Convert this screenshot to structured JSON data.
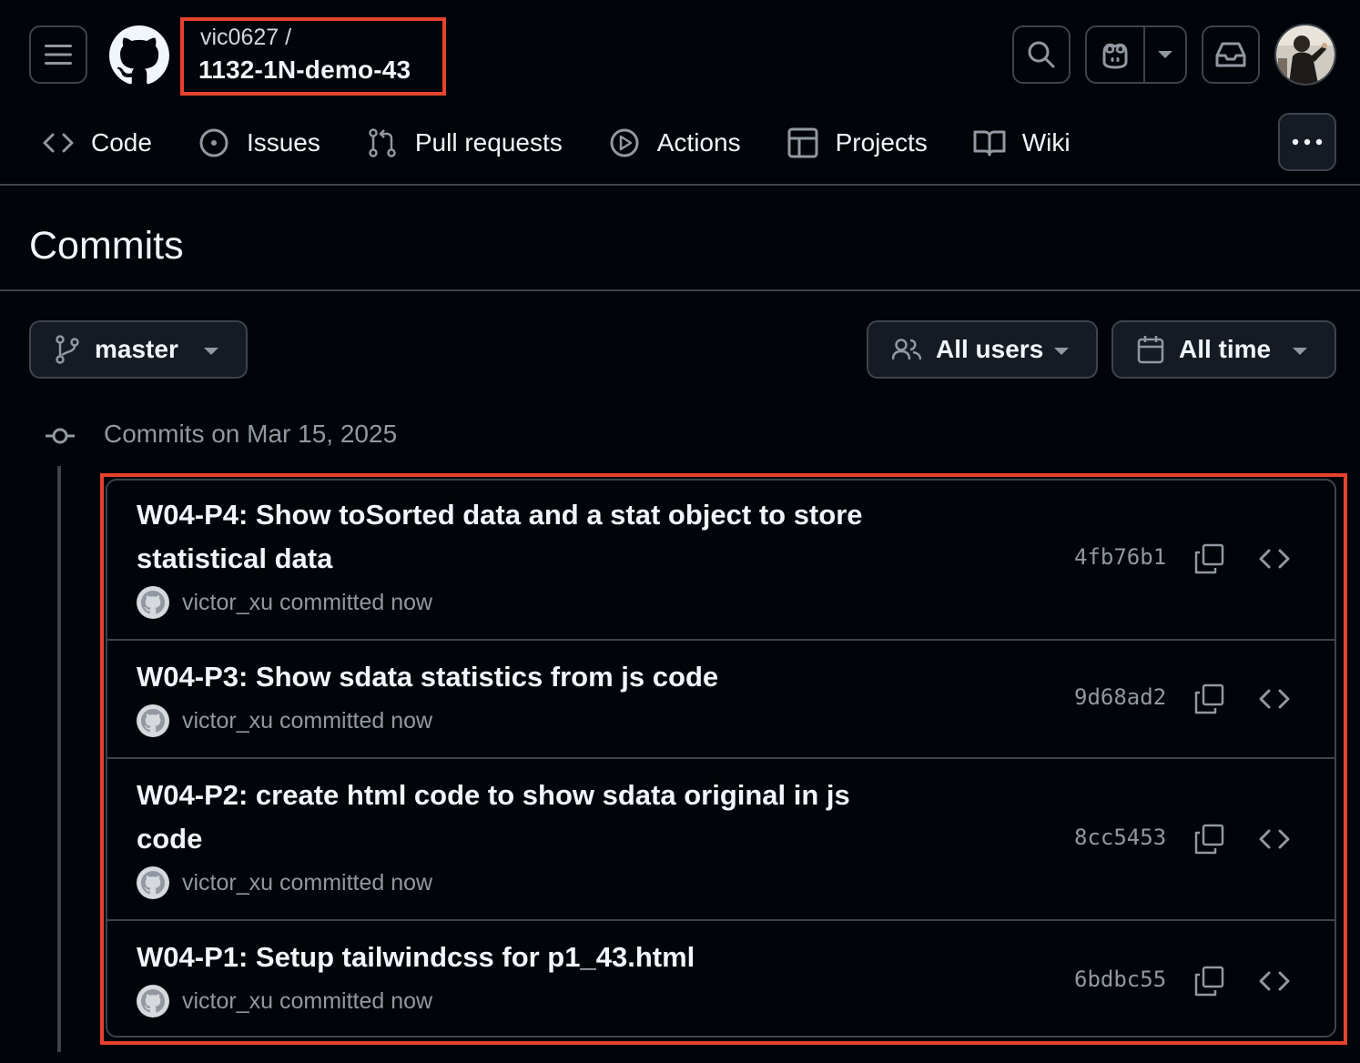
{
  "header": {
    "owner": "vic0627 /",
    "repo": "1132-1N-demo-43"
  },
  "tabs": [
    {
      "label": "Code",
      "icon": "code-icon"
    },
    {
      "label": "Issues",
      "icon": "issue-opened-icon"
    },
    {
      "label": "Pull requests",
      "icon": "git-pull-request-icon"
    },
    {
      "label": "Actions",
      "icon": "play-icon"
    },
    {
      "label": "Projects",
      "icon": "table-icon"
    },
    {
      "label": "Wiki",
      "icon": "book-icon"
    }
  ],
  "page": {
    "title": "Commits"
  },
  "filters": {
    "branch": "master",
    "users": "All users",
    "time": "All time"
  },
  "commit_group": {
    "date_label": "Commits on Mar 15, 2025",
    "commits": [
      {
        "message": "W04-P4: Show toSorted data and a stat object to store statistical data",
        "author_line": "victor_xu committed now",
        "sha": "4fb76b1"
      },
      {
        "message": "W04-P3: Show sdata statistics from js code",
        "author_line": "victor_xu committed now",
        "sha": "9d68ad2"
      },
      {
        "message": "W04-P2: create html code to show sdata original in js code",
        "author_line": "victor_xu committed now",
        "sha": "8cc5453"
      },
      {
        "message": "W04-P1: Setup tailwindcss for p1_43.html",
        "author_line": "victor_xu committed now",
        "sha": "6bdbc55"
      }
    ]
  },
  "colors": {
    "background": "#010409",
    "border": "#3d444d",
    "text": "#f0f6fc",
    "muted": "#9198a1",
    "highlight": "#e5432d"
  }
}
